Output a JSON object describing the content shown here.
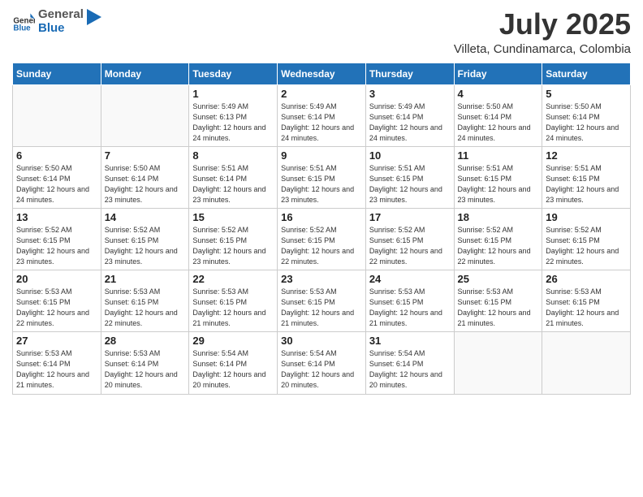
{
  "header": {
    "logo_general": "General",
    "logo_blue": "Blue",
    "month_year": "July 2025",
    "location": "Villeta, Cundinamarca, Colombia"
  },
  "weekdays": [
    "Sunday",
    "Monday",
    "Tuesday",
    "Wednesday",
    "Thursday",
    "Friday",
    "Saturday"
  ],
  "weeks": [
    [
      {
        "day": "",
        "empty": true
      },
      {
        "day": "",
        "empty": true
      },
      {
        "day": "1",
        "sunrise": "5:49 AM",
        "sunset": "6:13 PM",
        "daylight": "12 hours and 24 minutes."
      },
      {
        "day": "2",
        "sunrise": "5:49 AM",
        "sunset": "6:14 PM",
        "daylight": "12 hours and 24 minutes."
      },
      {
        "day": "3",
        "sunrise": "5:49 AM",
        "sunset": "6:14 PM",
        "daylight": "12 hours and 24 minutes."
      },
      {
        "day": "4",
        "sunrise": "5:50 AM",
        "sunset": "6:14 PM",
        "daylight": "12 hours and 24 minutes."
      },
      {
        "day": "5",
        "sunrise": "5:50 AM",
        "sunset": "6:14 PM",
        "daylight": "12 hours and 24 minutes."
      }
    ],
    [
      {
        "day": "6",
        "sunrise": "5:50 AM",
        "sunset": "6:14 PM",
        "daylight": "12 hours and 24 minutes."
      },
      {
        "day": "7",
        "sunrise": "5:50 AM",
        "sunset": "6:14 PM",
        "daylight": "12 hours and 23 minutes."
      },
      {
        "day": "8",
        "sunrise": "5:51 AM",
        "sunset": "6:14 PM",
        "daylight": "12 hours and 23 minutes."
      },
      {
        "day": "9",
        "sunrise": "5:51 AM",
        "sunset": "6:15 PM",
        "daylight": "12 hours and 23 minutes."
      },
      {
        "day": "10",
        "sunrise": "5:51 AM",
        "sunset": "6:15 PM",
        "daylight": "12 hours and 23 minutes."
      },
      {
        "day": "11",
        "sunrise": "5:51 AM",
        "sunset": "6:15 PM",
        "daylight": "12 hours and 23 minutes."
      },
      {
        "day": "12",
        "sunrise": "5:51 AM",
        "sunset": "6:15 PM",
        "daylight": "12 hours and 23 minutes."
      }
    ],
    [
      {
        "day": "13",
        "sunrise": "5:52 AM",
        "sunset": "6:15 PM",
        "daylight": "12 hours and 23 minutes."
      },
      {
        "day": "14",
        "sunrise": "5:52 AM",
        "sunset": "6:15 PM",
        "daylight": "12 hours and 23 minutes."
      },
      {
        "day": "15",
        "sunrise": "5:52 AM",
        "sunset": "6:15 PM",
        "daylight": "12 hours and 23 minutes."
      },
      {
        "day": "16",
        "sunrise": "5:52 AM",
        "sunset": "6:15 PM",
        "daylight": "12 hours and 22 minutes."
      },
      {
        "day": "17",
        "sunrise": "5:52 AM",
        "sunset": "6:15 PM",
        "daylight": "12 hours and 22 minutes."
      },
      {
        "day": "18",
        "sunrise": "5:52 AM",
        "sunset": "6:15 PM",
        "daylight": "12 hours and 22 minutes."
      },
      {
        "day": "19",
        "sunrise": "5:52 AM",
        "sunset": "6:15 PM",
        "daylight": "12 hours and 22 minutes."
      }
    ],
    [
      {
        "day": "20",
        "sunrise": "5:53 AM",
        "sunset": "6:15 PM",
        "daylight": "12 hours and 22 minutes."
      },
      {
        "day": "21",
        "sunrise": "5:53 AM",
        "sunset": "6:15 PM",
        "daylight": "12 hours and 22 minutes."
      },
      {
        "day": "22",
        "sunrise": "5:53 AM",
        "sunset": "6:15 PM",
        "daylight": "12 hours and 21 minutes."
      },
      {
        "day": "23",
        "sunrise": "5:53 AM",
        "sunset": "6:15 PM",
        "daylight": "12 hours and 21 minutes."
      },
      {
        "day": "24",
        "sunrise": "5:53 AM",
        "sunset": "6:15 PM",
        "daylight": "12 hours and 21 minutes."
      },
      {
        "day": "25",
        "sunrise": "5:53 AM",
        "sunset": "6:15 PM",
        "daylight": "12 hours and 21 minutes."
      },
      {
        "day": "26",
        "sunrise": "5:53 AM",
        "sunset": "6:15 PM",
        "daylight": "12 hours and 21 minutes."
      }
    ],
    [
      {
        "day": "27",
        "sunrise": "5:53 AM",
        "sunset": "6:14 PM",
        "daylight": "12 hours and 21 minutes."
      },
      {
        "day": "28",
        "sunrise": "5:53 AM",
        "sunset": "6:14 PM",
        "daylight": "12 hours and 20 minutes."
      },
      {
        "day": "29",
        "sunrise": "5:54 AM",
        "sunset": "6:14 PM",
        "daylight": "12 hours and 20 minutes."
      },
      {
        "day": "30",
        "sunrise": "5:54 AM",
        "sunset": "6:14 PM",
        "daylight": "12 hours and 20 minutes."
      },
      {
        "day": "31",
        "sunrise": "5:54 AM",
        "sunset": "6:14 PM",
        "daylight": "12 hours and 20 minutes."
      },
      {
        "day": "",
        "empty": true
      },
      {
        "day": "",
        "empty": true
      }
    ]
  ]
}
